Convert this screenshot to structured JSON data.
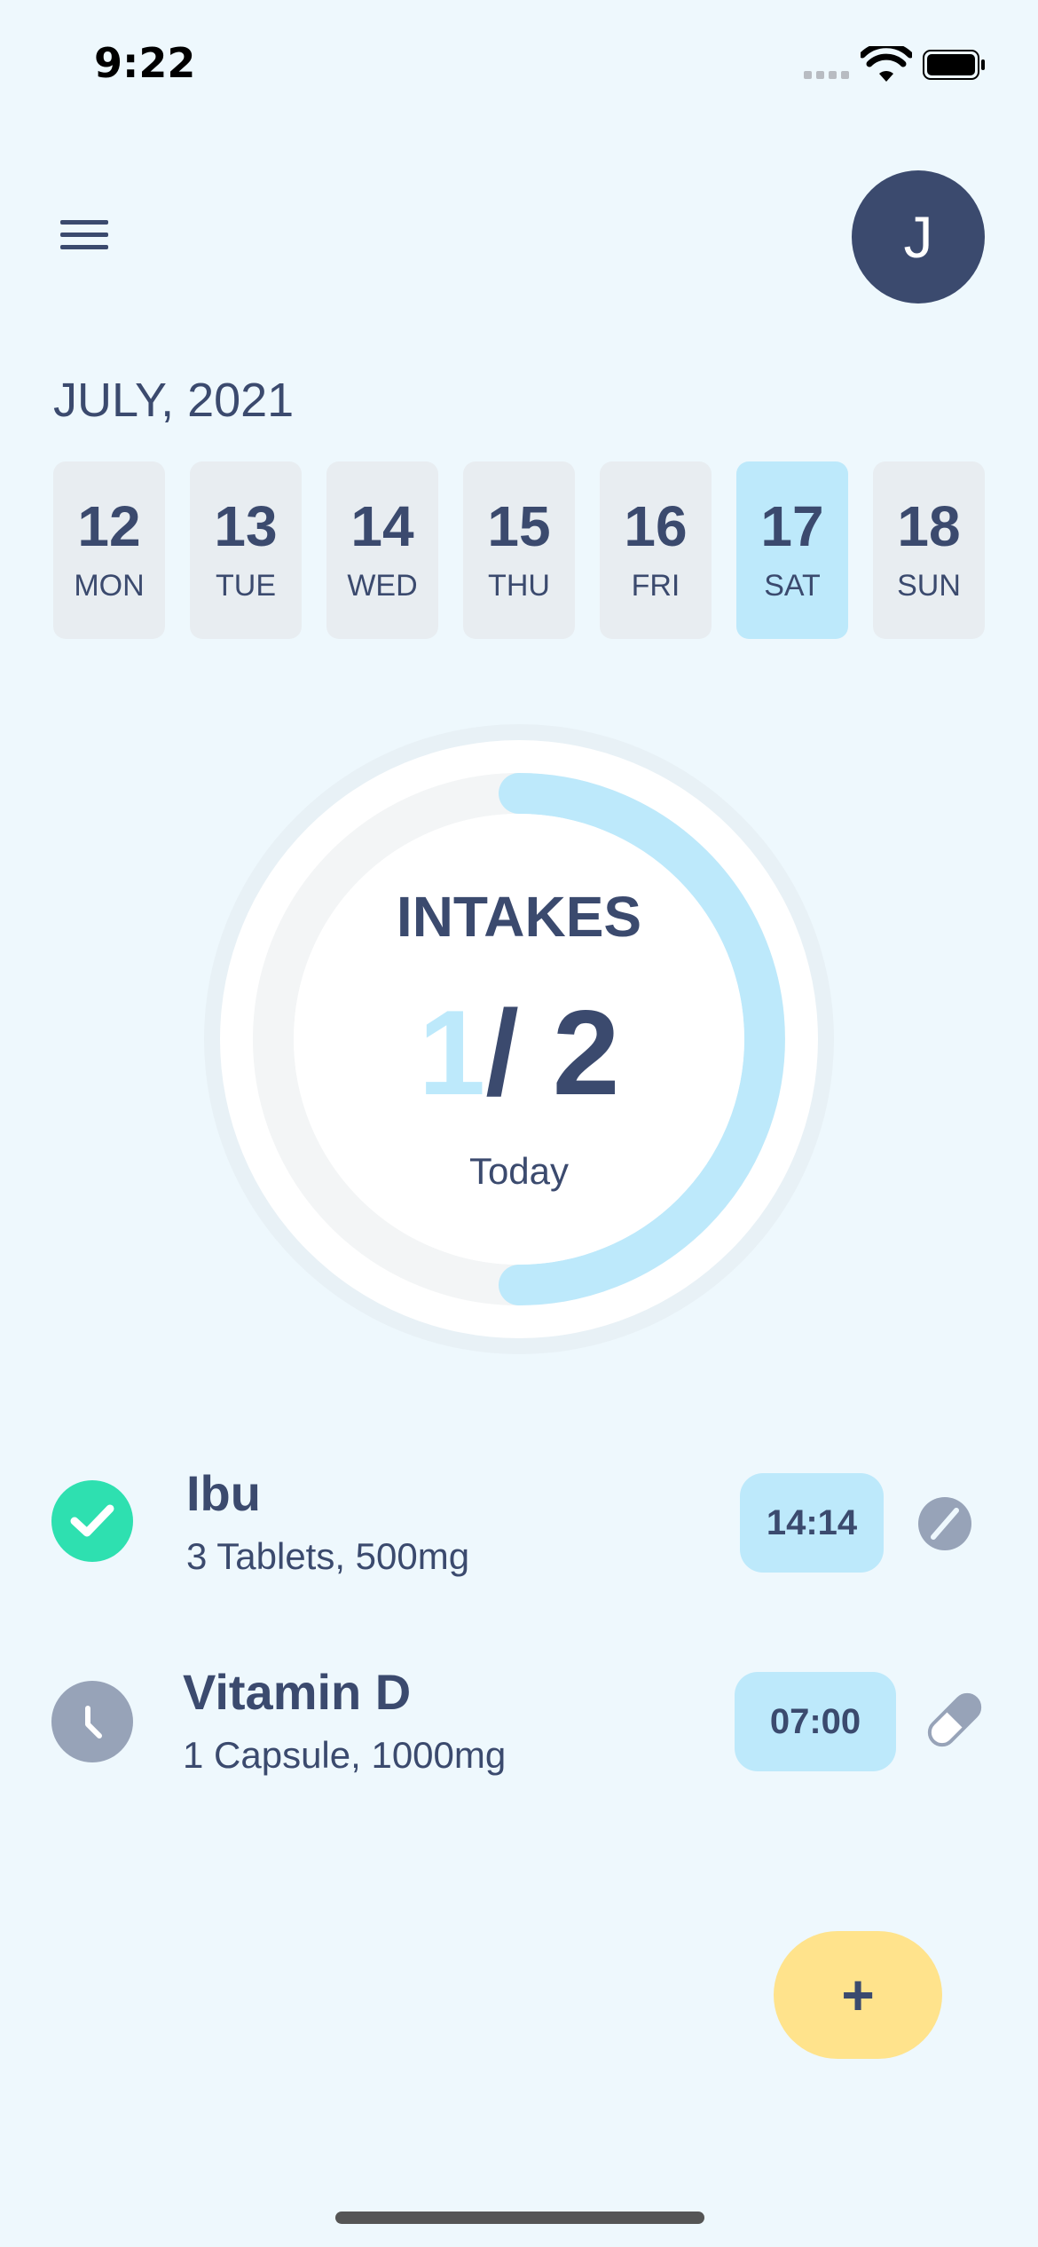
{
  "status_bar": {
    "time": "9:22"
  },
  "header": {
    "avatar_initial": "J"
  },
  "calendar": {
    "month_label": "JULY, 2021",
    "days": [
      {
        "num": "12",
        "dow": "MON",
        "selected": false
      },
      {
        "num": "13",
        "dow": "TUE",
        "selected": false
      },
      {
        "num": "14",
        "dow": "WED",
        "selected": false
      },
      {
        "num": "15",
        "dow": "THU",
        "selected": false
      },
      {
        "num": "16",
        "dow": "FRI",
        "selected": false
      },
      {
        "num": "17",
        "dow": "SAT",
        "selected": true
      },
      {
        "num": "18",
        "dow": "SUN",
        "selected": false
      }
    ]
  },
  "intakes": {
    "title": "INTAKES",
    "taken": "1",
    "slash": "/",
    "total": "2",
    "subtitle": "Today",
    "progress_fraction": 0.5
  },
  "medications": [
    {
      "name": "Ibu",
      "dose": "3 Tablets, 500mg",
      "time": "14:14",
      "status": "taken",
      "status_icon": "check-icon",
      "type_icon": "tablet-icon"
    },
    {
      "name": "Vitamin D",
      "dose": "1 Capsule, 1000mg",
      "time": "07:00",
      "status": "pending",
      "status_icon": "clock-icon",
      "type_icon": "capsule-icon"
    }
  ],
  "fab": {
    "label": "+"
  },
  "colors": {
    "background": "#EEF8FD",
    "primary": "#3B4A6E",
    "accent": "#BDE9FB",
    "success": "#2EE0B0",
    "pending": "#97A3B8",
    "fab": "#FFE38C"
  }
}
